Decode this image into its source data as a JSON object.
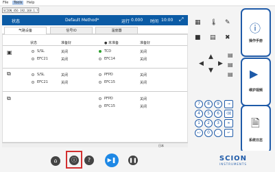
{
  "menubar": {
    "items": [
      "File",
      "Tools",
      "Help"
    ]
  },
  "address": {
    "text": "SCION_456 192.168.1.76"
  },
  "header": {
    "label": "状态",
    "method": "Default Method*",
    "run_label": "运行",
    "run_value": "0.000",
    "time_label": "时间",
    "time_value": "10:00"
  },
  "tabs": [
    "气路设备",
    "信号IO",
    "温度器"
  ],
  "columns": {
    "status": "状态",
    "prepare": "准备好",
    "on": "● 未准备",
    "prepare2": "准备好"
  },
  "rows": [
    {
      "left_name": "S/SL",
      "left_status": "关闭",
      "right_name": "TCD",
      "right_status": "关闭",
      "on": true
    },
    {
      "left_name": "EFC21",
      "left_status": "关闭",
      "right_name": "EFC14",
      "right_status": "关闭",
      "on": false
    },
    {
      "left_name": "S/SL",
      "left_status": "关闭",
      "right_name": "PFPD",
      "right_status": "关闭",
      "on": false
    },
    {
      "left_name": "EFC21",
      "left_status": "关闭",
      "right_name": "EFC15",
      "right_status": "关闭",
      "on": false
    },
    {
      "left_name": "",
      "left_status": "",
      "right_name": "PFPD",
      "right_status": "关闭",
      "on": false
    },
    {
      "left_name": "",
      "left_status": "",
      "right_name": "EFC15",
      "right_status": "关闭",
      "on": false
    }
  ],
  "statusbar": {
    "text": "日本"
  },
  "side": {
    "manual": "操作手册",
    "video": "维护视频",
    "log": "系统日志"
  },
  "keypad": {
    "keys": [
      "7",
      "8",
      "9",
      "4",
      "5",
      "6",
      "1",
      "2",
      "3",
      "+/-",
      "0",
      "."
    ]
  },
  "logo": {
    "line1": "SCION",
    "line2": "INSTRUMENTS"
  },
  "colors": {
    "header": "#0b5ba5",
    "accent": "#1e5aa8",
    "highlight": "#d32f2f"
  }
}
